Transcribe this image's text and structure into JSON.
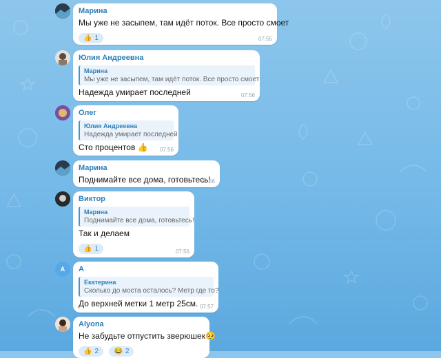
{
  "colors": {
    "accent": "#2e7fb8",
    "bubble": "#ffffff",
    "background": "#7dbde9"
  },
  "messages": [
    {
      "sender": "Марина",
      "text": "Мы уже не засыпем, там идёт поток. Все просто смоет",
      "time": "07:55",
      "reactions": [
        {
          "icon": "thumbs-up-icon",
          "emoji": "👍",
          "count": "1"
        }
      ]
    },
    {
      "sender": "Юлия Андреевна",
      "reply_author": "Марина",
      "reply_text": "Мы уже не засыпем, там идёт поток. Все просто смоет",
      "text": "Надежда умирает последней",
      "time": "07:56"
    },
    {
      "sender": "Олег",
      "reply_author": "Юлия Андреевна",
      "reply_text": "Надежда умирает последней",
      "text": "Сто процентов 👍",
      "time": "07:56"
    },
    {
      "sender": "Марина",
      "text": "Поднимайте все дома, готовьтесь!",
      "time": "07:56"
    },
    {
      "sender": "Виктор",
      "reply_author": "Марина",
      "reply_text": "Поднимайте все дома, готовьтесь!",
      "text": "Так и делаем",
      "time": "07:56",
      "reactions": [
        {
          "icon": "thumbs-up-icon",
          "emoji": "👍",
          "count": "1"
        }
      ]
    },
    {
      "sender": "А",
      "avatar_letter": "A",
      "reply_author": "Екатерина",
      "reply_text": "Сколько до моста осталось? Метр где то?",
      "text": "До верхней метки 1 метр 25см.",
      "time": "07:57"
    },
    {
      "sender": "Alyona",
      "text": "Не забудьте отпустить зверюшек🥺",
      "reactions": [
        {
          "icon": "thumbs-up-icon",
          "emoji": "👍",
          "count": "2"
        },
        {
          "icon": "tears-of-joy-icon",
          "emoji": "😂",
          "count": "2"
        }
      ]
    }
  ]
}
